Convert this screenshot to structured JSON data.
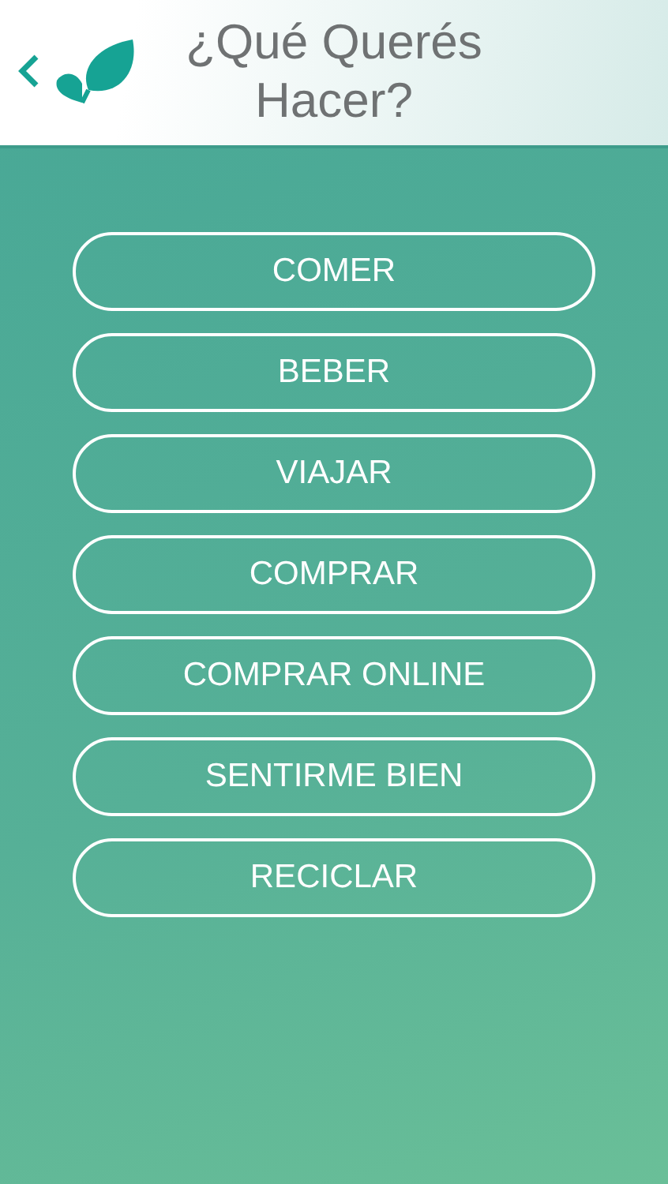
{
  "header": {
    "title": "¿Qué Querés Hacer?"
  },
  "options": [
    {
      "label": "COMER"
    },
    {
      "label": "BEBER"
    },
    {
      "label": "VIAJAR"
    },
    {
      "label": "COMPRAR"
    },
    {
      "label": "COMPRAR ONLINE"
    },
    {
      "label": "SENTIRME BIEN"
    },
    {
      "label": "RECICLAR"
    }
  ]
}
